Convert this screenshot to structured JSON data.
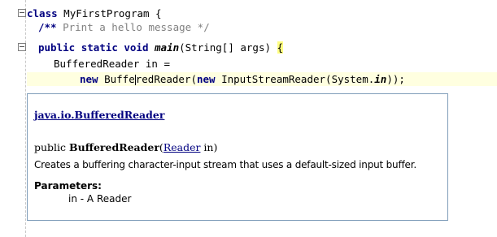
{
  "editor": {
    "lines": [
      {
        "kw": "class",
        "rest": " MyFirstProgram {"
      },
      {
        "comment_open": "/**",
        "comment_text": " Print a hello message ",
        "comment_close": "*/"
      },
      {
        "kw1": "public",
        "kw2": "static",
        "kw3": "void",
        "method": "main",
        "params": "(String[] args) ",
        "brace": "{"
      },
      {
        "text": "BufferedReader in ="
      },
      {
        "kw": "new",
        "before_caret": " Buffe",
        "after_caret": "edReader(",
        "kw2": "new",
        "mid": " InputStreamReader(System.",
        "field": "in",
        "end": "));"
      }
    ],
    "caret_char": "r"
  },
  "javadoc": {
    "class_link": "java.io.BufferedReader",
    "sig_modifier": "public",
    "sig_name": "BufferedReader",
    "sig_param_type": "Reader",
    "sig_param_rest": " in)",
    "description": "Creates a buffering character-input stream that uses a default-sized input buffer.",
    "params_title": "Parameters:",
    "param_name": "in",
    "param_sep": " - ",
    "param_desc": "A Reader"
  }
}
